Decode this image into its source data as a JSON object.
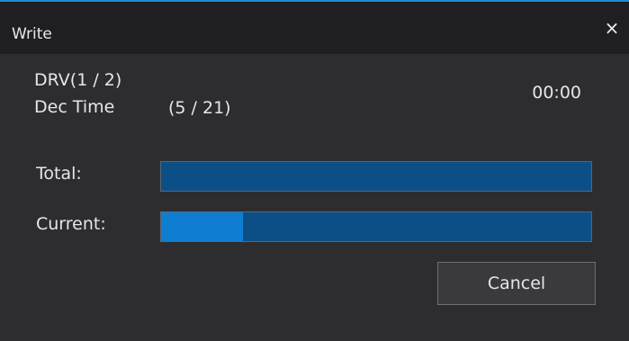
{
  "window": {
    "title": "Write",
    "close_glyph": "×"
  },
  "info": {
    "drive": "DRV(1 / 2)",
    "dec_time_label": "Dec Time",
    "dec_time_count": "(5 / 21)",
    "elapsed": "00:00"
  },
  "progress": {
    "total_label": "Total:",
    "total_fraction": 0.0,
    "current_label": "Current:",
    "current_fraction": 0.19
  },
  "buttons": {
    "cancel_label": "Cancel"
  },
  "colors": {
    "accent": "#1a8ad4",
    "bar_track": "#0c4f86",
    "bar_fill": "#0f7ed2",
    "background": "#2d2d30"
  },
  "icons": {
    "close": "close-icon"
  }
}
